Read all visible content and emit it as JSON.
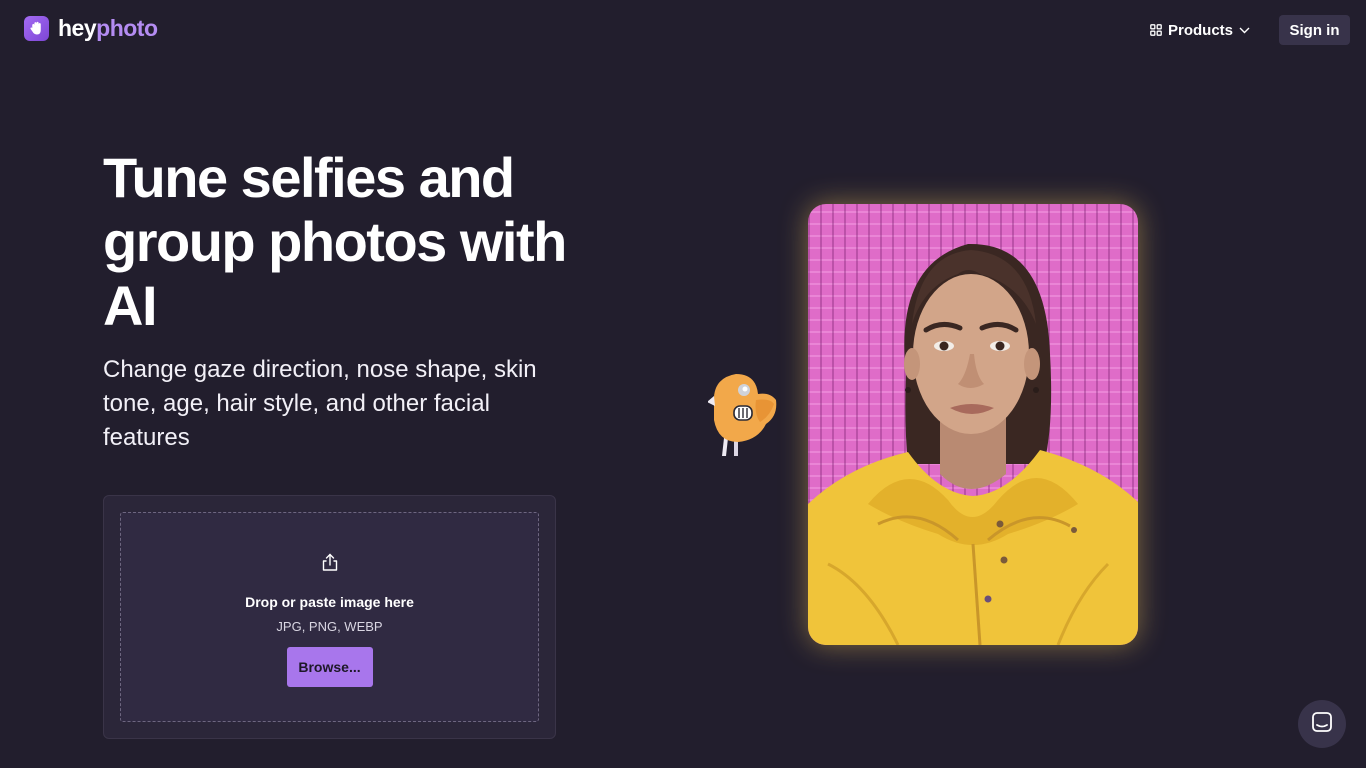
{
  "header": {
    "logo_part1": "hey",
    "logo_part2": "photo",
    "products_label": "Products",
    "signin_label": "Sign in"
  },
  "hero": {
    "title": "Tune selfies and group photos with AI",
    "subtitle": "Change gaze direction, nose shape, skin tone, age, hair style, and other facial features"
  },
  "upload": {
    "drop_text": "Drop or paste image here",
    "formats_text": "JPG, PNG, WEBP",
    "browse_label": "Browse..."
  },
  "colors": {
    "background": "#221e2d",
    "accent": "#a876ec",
    "logo_accent": "#b48cf2",
    "photo_background": "#df6cc8",
    "jacket": "#f0c43a"
  },
  "icons": {
    "logo": "hand-wave-icon",
    "products": "grid-icon",
    "products_caret": "chevron-down-icon",
    "upload": "upload-icon",
    "chat": "chat-icon",
    "mascot": "bird-mascot-icon"
  }
}
